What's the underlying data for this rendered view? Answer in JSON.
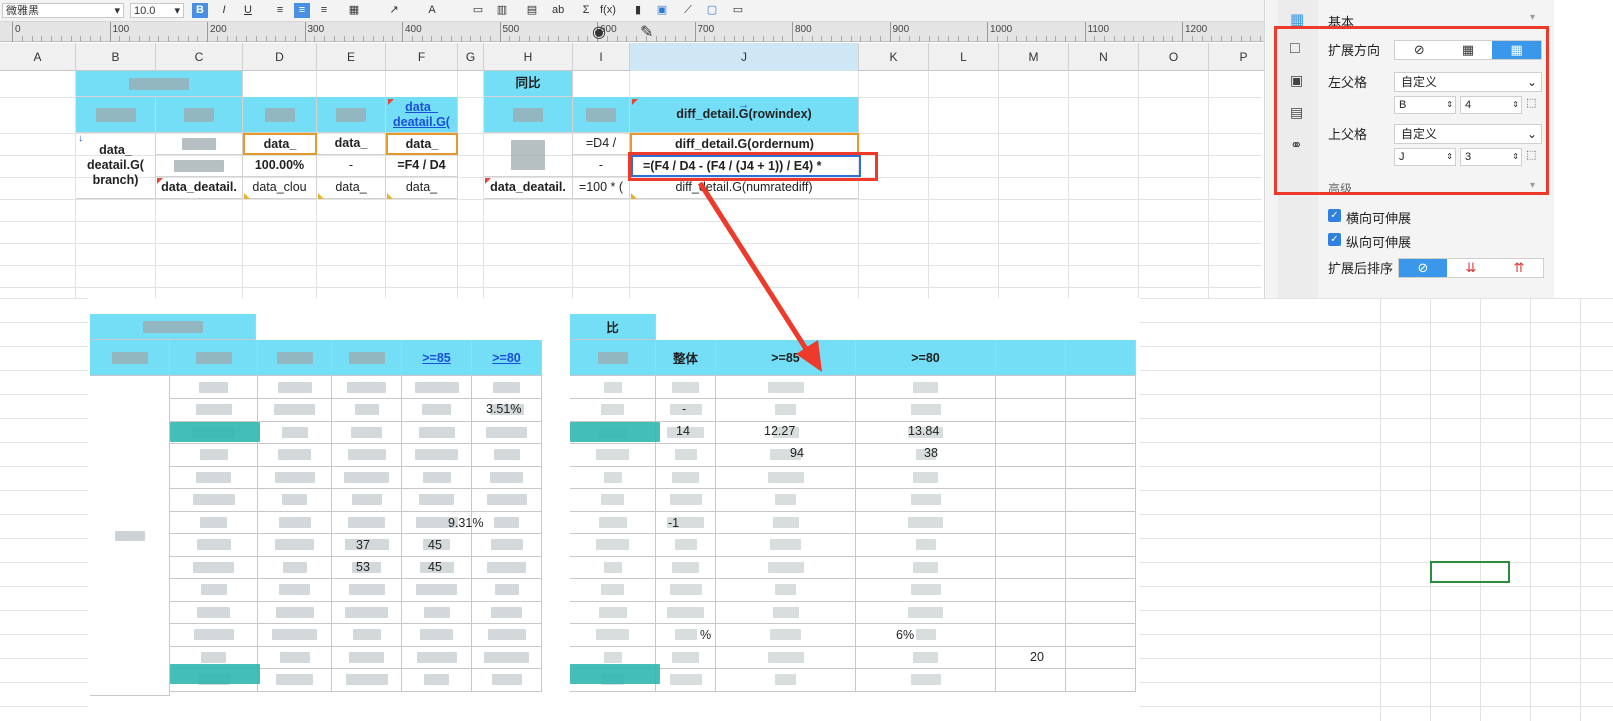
{
  "toolbar": {
    "font_name": "微雅黑",
    "font_size": "10.0",
    "bold": "B",
    "italic": "I",
    "underline": "U",
    "ab_label": "ab"
  },
  "ruler": {
    "labels": [
      "0",
      "100",
      "200",
      "300",
      "400",
      "500",
      "600",
      "700",
      "800",
      "900",
      "1000",
      "1100",
      "1200"
    ]
  },
  "column_headers": [
    "A",
    "B",
    "C",
    "D",
    "E",
    "F",
    "G",
    "H",
    "I",
    "J",
    "K",
    "L",
    "M",
    "N",
    "O",
    "P"
  ],
  "design": {
    "yoy_header": "同比",
    "f_header_link": "data_\ndeatail.G(",
    "j_header": "diff_detail.G(rowindex)",
    "b_row3": "data_\ndeatail.G(\nbranch)",
    "d_row3": "data_",
    "e_row3": "data_",
    "f_row3": "data_",
    "i_row3": "=D4 /",
    "j_row3": "diff_detail.G(ordernum)",
    "d_row4": "100.00%",
    "e_row4": "-",
    "f_row4": "=F4 / D4",
    "i_row4": "-",
    "j_row4_formula": "=(F4 / D4 - (F4 / (J4 + 1)) / E4) *",
    "c_row5": "data_deatail.",
    "d_row5": "data_clou",
    "e_row5": "data_",
    "f_row5": "data_",
    "h_row5": "data_deatail.",
    "i_row5": "=100 * (",
    "j_row5": "diff_detail.G(numratediff)"
  },
  "panel": {
    "basic_title": "基本",
    "expand_direction": "扩展方向",
    "left_parent": "左父格",
    "left_parent_value": "自定义",
    "left_col": "B",
    "left_row": "4",
    "top_parent": "上父格",
    "top_parent_value": "自定义",
    "top_col": "J",
    "top_row": "3",
    "advanced_title": "高级",
    "h_expand": "横向可伸展",
    "v_expand": "纵向可伸展",
    "sort_after_expand": "扩展后排序",
    "accent_color": "#3b97ea"
  },
  "preview": {
    "yoy_header": "比",
    "ge85_link": ">=85",
    "ge80_link": ">=80",
    "overall": "整体",
    "ge85": ">=85",
    "ge80": ">=80",
    "row1_overall": "%",
    "row2_dash": "-",
    "row2_pct": "3.51%",
    "row3_val": "14",
    "row3_ge85": "12.27",
    "row3_ge80": "13.84",
    "row4_ge85": "94",
    "row4_ge80": "38",
    "row6_dash": "-",
    "row7_pct": "9.31%",
    "row7_minus": "-1",
    "row8_val": "37",
    "row8_pct": "45",
    "row9_val": "53",
    "row9_pct": "45",
    "sum_pct": "%",
    "sum_ge80": "6%",
    "sum_val": "20"
  },
  "annotation_color": "#ee3a2a"
}
